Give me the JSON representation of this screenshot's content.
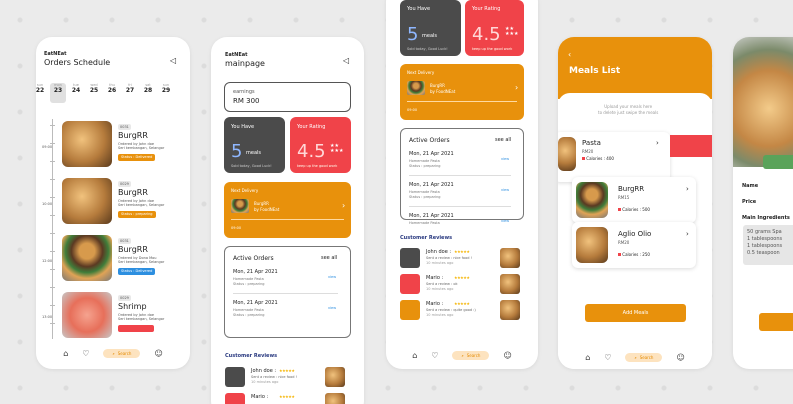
{
  "colors": {
    "accent": "#e8910c",
    "red": "#f04349",
    "dark": "#4b4b4b",
    "blue": "#2d8fe0"
  },
  "p1": {
    "brand": "EatNEat",
    "title": "Orders Schedule",
    "days": [
      {
        "d": "sun",
        "n": "22"
      },
      {
        "d": "mon",
        "n": "23"
      },
      {
        "d": "tue",
        "n": "24"
      },
      {
        "d": "wed",
        "n": "25"
      },
      {
        "d": "thu",
        "n": "26"
      },
      {
        "d": "fri",
        "n": "27"
      },
      {
        "d": "sat",
        "n": "28"
      },
      {
        "d": "sun",
        "n": "29"
      }
    ],
    "times": [
      "09:00",
      "10:00",
      "12:00",
      "13:00"
    ],
    "orders": [
      {
        "id": "0031",
        "name": "BurgRR",
        "by": "Ordered by John doe",
        "addr": "Seri kembangan, Selangor",
        "status": "Status : Delivered"
      },
      {
        "id": "0029",
        "name": "BurgRR",
        "by": "Ordered by John doe",
        "addr": "Seri kembangan, Selangor",
        "status": "Status : preparing"
      },
      {
        "id": "0031",
        "name": "BurgRR",
        "by": "Ordered by Dona Mou",
        "addr": "Seri kembangan, Selangor",
        "status": "Status : Delivered"
      },
      {
        "id": "0029",
        "name": "Shrimp",
        "by": "Ordered by John doe",
        "addr": "Seri kembangan, Selangor",
        "status": ""
      }
    ],
    "search": "Search"
  },
  "p2": {
    "brand": "EatNEat",
    "title": "mainpage",
    "earnings_label": "earnings",
    "earnings": "RM 300",
    "you_have": "You Have",
    "meals_num": "5",
    "meals_word": "meals",
    "today": "Sold today, Good Luck!",
    "rating_label": "Your Rating",
    "rating": "4.5",
    "stars": "★★\n★★★",
    "keep": "keep up the good work",
    "next": "Next Delivery",
    "next_item": "BurgRR",
    "next_by": "by FoodNEat",
    "next_time": "09:00",
    "active": "Active Orders",
    "see_all": "see all",
    "rows": [
      {
        "date": "Mon, 21 Apr 2021",
        "sub": "Homemade Pasta",
        "status": "Status : preparing",
        "link": "view"
      },
      {
        "date": "Mon, 21 Apr 2021",
        "sub": "Homemade Pasta",
        "status": "Status : preparing",
        "link": "view"
      }
    ],
    "reviews_title": "Customer Reviews",
    "reviews": [
      {
        "name": "John doe :",
        "stars": "★★★★★",
        "text": "Sent a review : nice food !",
        "time": "10 minutes ago"
      },
      {
        "name": "Mario :",
        "stars": "★★★★★",
        "text": "",
        "time": ""
      }
    ]
  },
  "p3": {
    "you_have": "You Have",
    "meals_num": "5",
    "meals_word": "meals",
    "today": "Sold today, Good Luck!",
    "rating_label": "Your Rating",
    "rating": "4.5",
    "keep": "keep up the good work",
    "next": "Next Delivery",
    "next_item": "BurgRR",
    "next_by": "by FoodNEat",
    "next_time": "09:00",
    "active": "Active Orders",
    "see_all": "see all",
    "rows": [
      {
        "date": "Mon, 21 Apr 2021",
        "sub": "Homemade Pasta",
        "status": "Status : preparing",
        "link": "view"
      },
      {
        "date": "Mon, 21 Apr 2021",
        "sub": "Homemade Pasta",
        "status": "Status : preparing",
        "link": "view"
      },
      {
        "date": "Mon, 21 Apr 2021",
        "sub": "Homemade Pasta",
        "status": "",
        "link": "view"
      }
    ],
    "reviews_title": "Customer Reviews",
    "reviews": [
      {
        "name": "John doe :",
        "stars": "★★★★★",
        "text": "Sent a review : nice food !",
        "time": "10 minutes ago"
      },
      {
        "name": "Mario :",
        "stars": "★★★★★",
        "text": "Sent a review : ok",
        "time": "10 minutes ago"
      },
      {
        "name": "Mario :",
        "stars": "★★★★★",
        "text": "Sent a review : quite good :)",
        "time": "10 minutes ago"
      }
    ],
    "search": "Search"
  },
  "p4": {
    "title": "Meals List",
    "hint": "Upload your meals here\nto delete just swipe the meals",
    "meals": [
      {
        "name": "Pasta",
        "price": "RM20",
        "cal": "Calories : 400"
      },
      {
        "name": "BurgRR",
        "price": "RM15",
        "cal": "Calories : 500"
      },
      {
        "name": "Aglio Olio",
        "price": "RM20",
        "cal": "Calories : 250"
      }
    ],
    "add": "Add Meals",
    "search": "Search"
  },
  "p5": {
    "name_label": "Name",
    "price_label": "Price",
    "ing_label": "Main Ingredients",
    "ingredients": "50 grams Spa\n1 tablespoons\n1 tablespoons\n0.5 teaspoon"
  }
}
